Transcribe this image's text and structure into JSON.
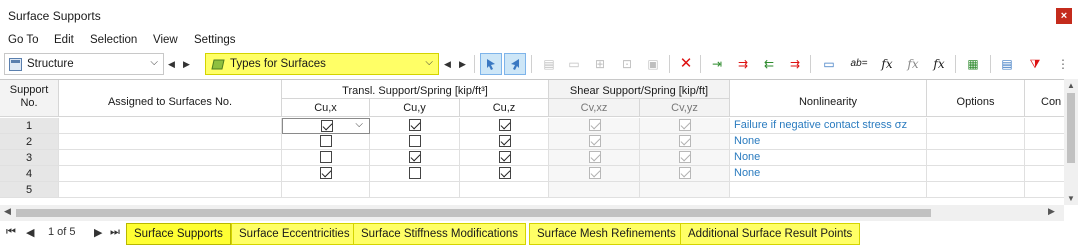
{
  "window": {
    "title": "Surface Supports",
    "close_label": "×"
  },
  "menu": [
    "Go To",
    "Edit",
    "Selection",
    "View",
    "Settings"
  ],
  "toolbar": {
    "structure_combo": "Structure",
    "types_combo": "Types for Surfaces"
  },
  "grid": {
    "headers": {
      "support_no": "Support No.",
      "assigned": "Assigned to Surfaces No.",
      "transl_group": "Transl. Support/Spring [kip/ft³]",
      "cux": "Cu,x",
      "cuy": "Cu,y",
      "cuz": "Cu,z",
      "shear_group": "Shear Support/Spring [kip/ft]",
      "cvxz": "Cv,xz",
      "cvyz": "Cv,yz",
      "nonlinearity": "Nonlinearity",
      "options": "Options",
      "comment": "Con"
    },
    "rows": [
      {
        "no": "1",
        "cux": true,
        "cuy": true,
        "cuz": true,
        "cvxz": true,
        "cvyz": true,
        "nonlinearity": "Failure if negative contact stress σz"
      },
      {
        "no": "2",
        "cux": false,
        "cuy": false,
        "cuz": true,
        "cvxz": true,
        "cvyz": true,
        "nonlinearity": "None"
      },
      {
        "no": "3",
        "cux": false,
        "cuy": true,
        "cuz": true,
        "cvxz": true,
        "cvyz": true,
        "nonlinearity": "None"
      },
      {
        "no": "4",
        "cux": true,
        "cuy": false,
        "cuz": true,
        "cvxz": true,
        "cvyz": true,
        "nonlinearity": "None"
      },
      {
        "no": "5",
        "cux": null,
        "cuy": null,
        "cuz": null,
        "cvxz": null,
        "cvyz": null,
        "nonlinearity": ""
      }
    ]
  },
  "pagination": {
    "text": "1 of 5"
  },
  "tabs": [
    "Surface Supports",
    "Surface Eccentricities",
    "Surface Stiffness Modifications",
    "Surface Mesh Refinements",
    "Additional Surface Result Points"
  ],
  "active_tab": "Surface Supports",
  "colors": {
    "tab_yellow": "#ffff66",
    "link_blue": "#2a7bbf",
    "close_red": "#c42b1c"
  }
}
